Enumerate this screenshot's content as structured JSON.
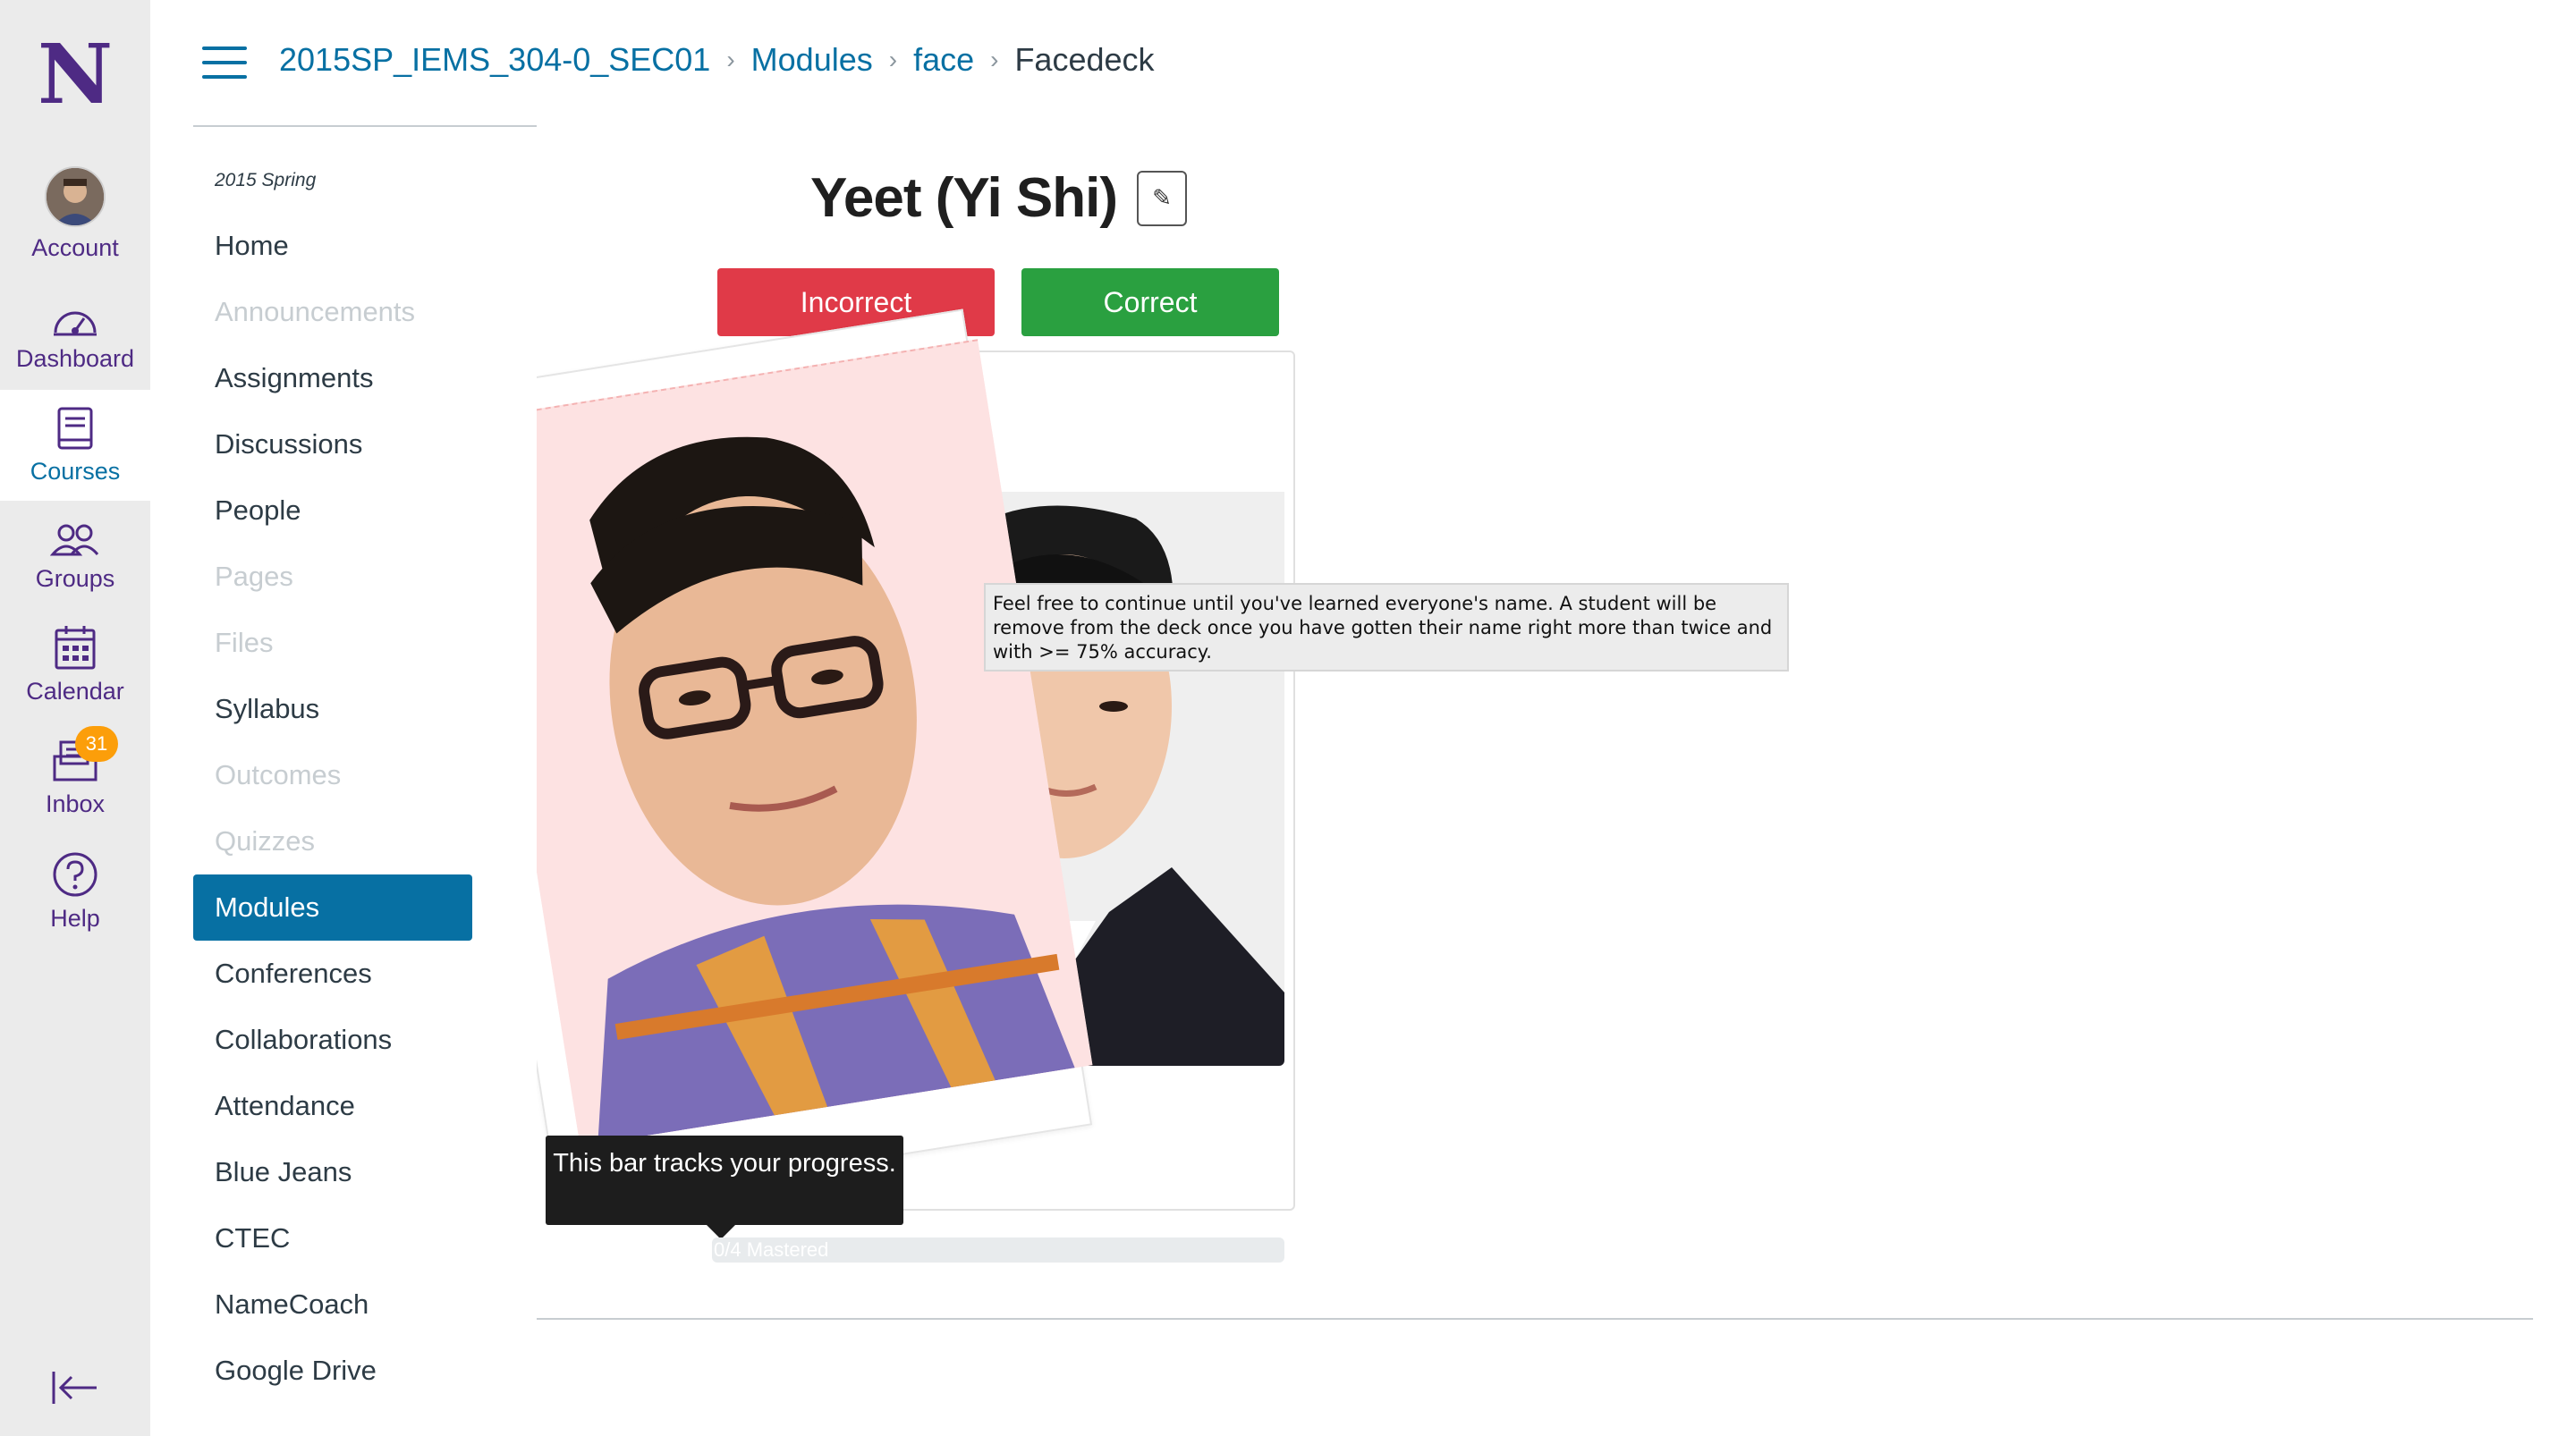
{
  "global_nav": {
    "logo": "N",
    "items": [
      {
        "label": "Account",
        "icon": "avatar"
      },
      {
        "label": "Dashboard",
        "icon": "dashboard-icon"
      },
      {
        "label": "Courses",
        "icon": "courses-icon"
      },
      {
        "label": "Groups",
        "icon": "groups-icon"
      },
      {
        "label": "Calendar",
        "icon": "calendar-icon"
      },
      {
        "label": "Inbox",
        "icon": "inbox-icon"
      },
      {
        "label": "Help",
        "icon": "help-icon"
      }
    ],
    "inbox_badge": "31",
    "colors": {
      "brand": "#4e2a84",
      "active": "#0770a3"
    }
  },
  "breadcrumb": {
    "course": "2015SP_IEMS_304-0_SEC01",
    "modules": "Modules",
    "module": "face",
    "current": "Facedeck"
  },
  "course_nav": {
    "term": "2015 Spring",
    "items": [
      {
        "label": "Home",
        "state": "normal"
      },
      {
        "label": "Announcements",
        "state": "disabled"
      },
      {
        "label": "Assignments",
        "state": "normal"
      },
      {
        "label": "Discussions",
        "state": "normal"
      },
      {
        "label": "People",
        "state": "normal"
      },
      {
        "label": "Pages",
        "state": "disabled"
      },
      {
        "label": "Files",
        "state": "disabled"
      },
      {
        "label": "Syllabus",
        "state": "normal"
      },
      {
        "label": "Outcomes",
        "state": "disabled"
      },
      {
        "label": "Quizzes",
        "state": "disabled"
      },
      {
        "label": "Modules",
        "state": "selected"
      },
      {
        "label": "Conferences",
        "state": "normal"
      },
      {
        "label": "Collaborations",
        "state": "normal"
      },
      {
        "label": "Attendance",
        "state": "normal"
      },
      {
        "label": "Blue Jeans",
        "state": "normal"
      },
      {
        "label": "CTEC",
        "state": "normal"
      },
      {
        "label": "NameCoach",
        "state": "normal"
      },
      {
        "label": "Google Drive",
        "state": "normal"
      }
    ]
  },
  "facedeck": {
    "student_name": "Yeet (Yi Shi)",
    "edit_icon": "✎",
    "incorrect_label": "Incorrect",
    "correct_label": "Correct",
    "help_tooltip": "Feel free to continue until you've learned everyone's name. A student will be remove from the deck once you have gotten their name right more than twice and with >= 75% accuracy.",
    "bar_tooltip": "This bar tracks your progress.",
    "progress_label": "0/4 Mastered",
    "progress_fraction": 0.0,
    "colors": {
      "incorrect": "#e03a48",
      "correct": "#2aa040"
    }
  }
}
